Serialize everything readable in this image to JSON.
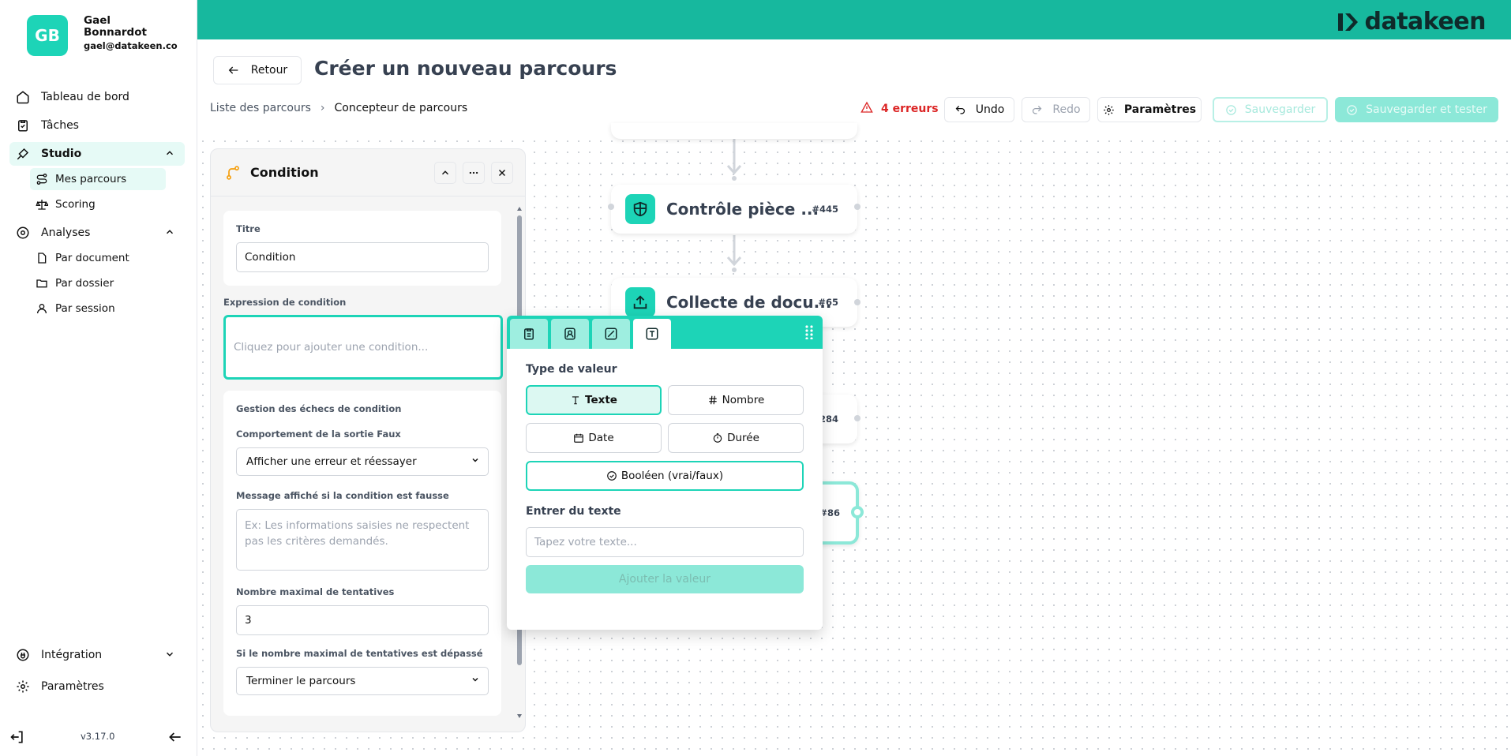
{
  "user": {
    "initials": "GB",
    "name": "Gael Bonnardot",
    "email": "gael@datakeen.co"
  },
  "nav": {
    "dashboard": "Tableau de bord",
    "tasks": "Tâches",
    "studio": "Studio",
    "studio_items": [
      "Mes parcours",
      "Scoring"
    ],
    "analyses": "Analyses",
    "analyses_items": [
      "Par document",
      "Par dossier",
      "Par session"
    ],
    "integration": "Intégration",
    "settings": "Paramètres"
  },
  "version": "v3.17.0",
  "brand": {
    "name": "datakeen",
    "color": "#17b89e",
    "accent": "#1dd4b7"
  },
  "header": {
    "back": "Retour",
    "title": "Créer un nouveau parcours",
    "breadcrumb": [
      "Liste des parcours",
      "Concepteur de parcours"
    ],
    "errors": "4 erreurs",
    "undo": "Undo",
    "redo": "Redo",
    "settings": "Paramètres",
    "save": "Sauvegarder",
    "save_test": "Sauvegarder et tester"
  },
  "nodes": [
    {
      "title": "Contrôle pièce ...",
      "id": "#445"
    },
    {
      "title": "Collecte de docu...",
      "id": "#65"
    },
    {
      "id": "284"
    },
    {
      "id": "#86"
    }
  ],
  "panel": {
    "title": "Condition",
    "title_label": "Titre",
    "title_value": "Condition",
    "expr_label": "Expression de condition",
    "expr_placeholder": "Cliquez pour ajouter une condition...",
    "fail_section": "Gestion des échecs de condition",
    "false_behavior_label": "Comportement de la sortie Faux",
    "false_behavior_value": "Afficher une erreur et réessayer",
    "message_label": "Message affiché si la condition est fausse",
    "message_placeholder": "Ex: Les informations saisies ne respectent pas les critères demandés.",
    "max_tries_label": "Nombre maximal de tentatives",
    "max_tries_value": "3",
    "exceeded_label": "Si le nombre maximal de tentatives est dépassé",
    "exceeded_value": "Terminer le parcours"
  },
  "popover": {
    "type_label": "Type de valeur",
    "types": [
      "Texte",
      "Nombre",
      "Date",
      "Durée",
      "Booléen (vrai/faux)"
    ],
    "text_label": "Entrer du texte",
    "text_placeholder": "Tapez votre texte...",
    "add": "Ajouter la valeur"
  }
}
